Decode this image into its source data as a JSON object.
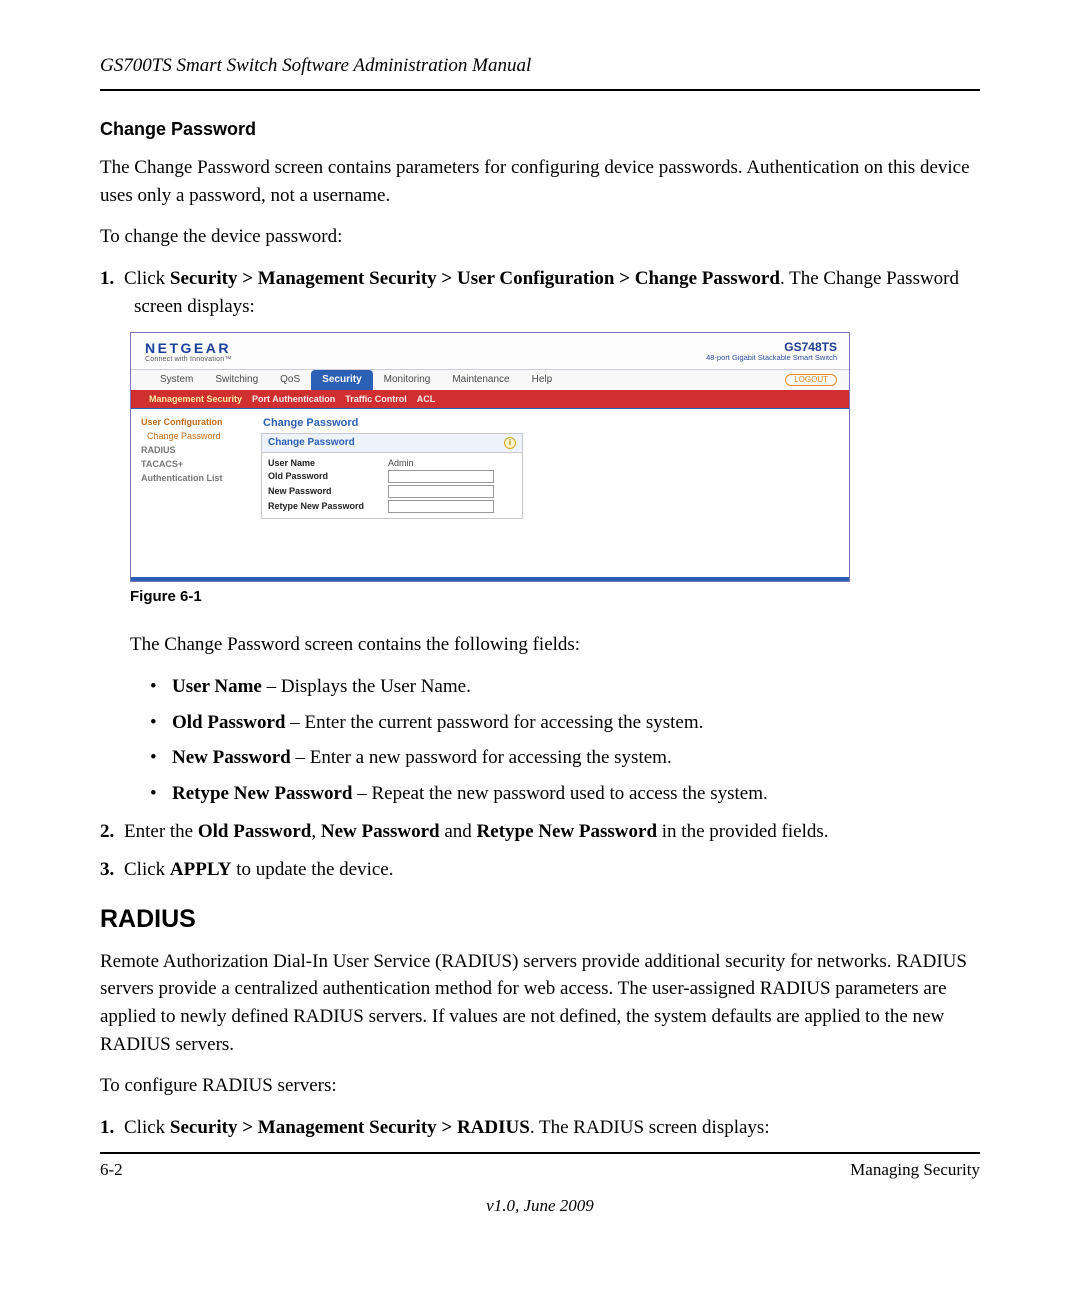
{
  "header": {
    "doc_title": "GS700TS Smart Switch Software Administration Manual"
  },
  "section1": {
    "heading": "Change Password",
    "intro": "The Change Password screen contains parameters for configuring device passwords. Authentication on this device uses only a password, not a username.",
    "lead": "To change the device password:",
    "step1_prefix": "Click ",
    "step1_path": "Security > Management Security > User Configuration > Change Password",
    "step1_suffix": ". The Change Password screen displays:",
    "fields_intro": "The Change Password screen contains the following fields:",
    "bullet1_term": "User Name",
    "bullet1_desc": " – Displays the User Name.",
    "bullet2_term": "Old Password",
    "bullet2_desc": " – Enter the current password for accessing the system.",
    "bullet3_term": "New Password",
    "bullet3_desc": " – Enter a new password for accessing the system.",
    "bullet4_term": "Retype New Password",
    "bullet4_desc": " – Repeat the new password used to access the system.",
    "step2_prefix": "Enter the ",
    "step2_a": "Old Password",
    "step2_mid1": ", ",
    "step2_b": "New Password",
    "step2_mid2": " and ",
    "step2_c": "Retype New Password",
    "step2_suffix": " in the provided fields.",
    "step3_prefix": "Click ",
    "step3_bold": "APPLY",
    "step3_suffix": " to update the device."
  },
  "figure": {
    "caption": "Figure 6-1"
  },
  "screenshot": {
    "brand": "NETGEAR",
    "brand_tag": "Connect with Innovation™",
    "model": "GS748TS",
    "model_desc": "48-port Gigabit Stackable Smart Switch",
    "tabs": [
      "System",
      "Switching",
      "QoS",
      "Security",
      "Monitoring",
      "Maintenance",
      "Help"
    ],
    "active_tab": "Security",
    "logout": "LOGOUT",
    "subtabs": [
      "Management Security",
      "Port Authentication",
      "Traffic Control",
      "ACL"
    ],
    "active_subtab": "Management Security",
    "sidebar": {
      "items": [
        {
          "label": "User Configuration",
          "kind": "parent"
        },
        {
          "label": "Change Password",
          "kind": "sel"
        },
        {
          "label": "RADIUS",
          "kind": "child"
        },
        {
          "label": "TACACS+",
          "kind": "child"
        },
        {
          "label": "Authentication List",
          "kind": "child"
        }
      ]
    },
    "panel": {
      "outer_title": "Change Password",
      "inner_title": "Change Password",
      "rows": {
        "user_label": "User Name",
        "user_value": "Admin",
        "old_label": "Old Password",
        "new_label": "New Password",
        "retype_label": "Retype New Password"
      }
    }
  },
  "section2": {
    "heading": "RADIUS",
    "para": "Remote Authorization Dial-In User Service (RADIUS) servers provide additional security for networks. RADIUS servers provide a centralized authentication method for web access. The user-assigned RADIUS parameters are applied to newly defined RADIUS servers. If values are not defined, the system defaults are applied to the new RADIUS servers.",
    "lead": "To configure RADIUS servers:",
    "step1_prefix": "Click ",
    "step1_path": "Security > Management Security > RADIUS",
    "step1_suffix": ". The RADIUS screen displays:"
  },
  "footer": {
    "page_num": "6-2",
    "section": "Managing Security",
    "version": "v1.0, June 2009"
  }
}
